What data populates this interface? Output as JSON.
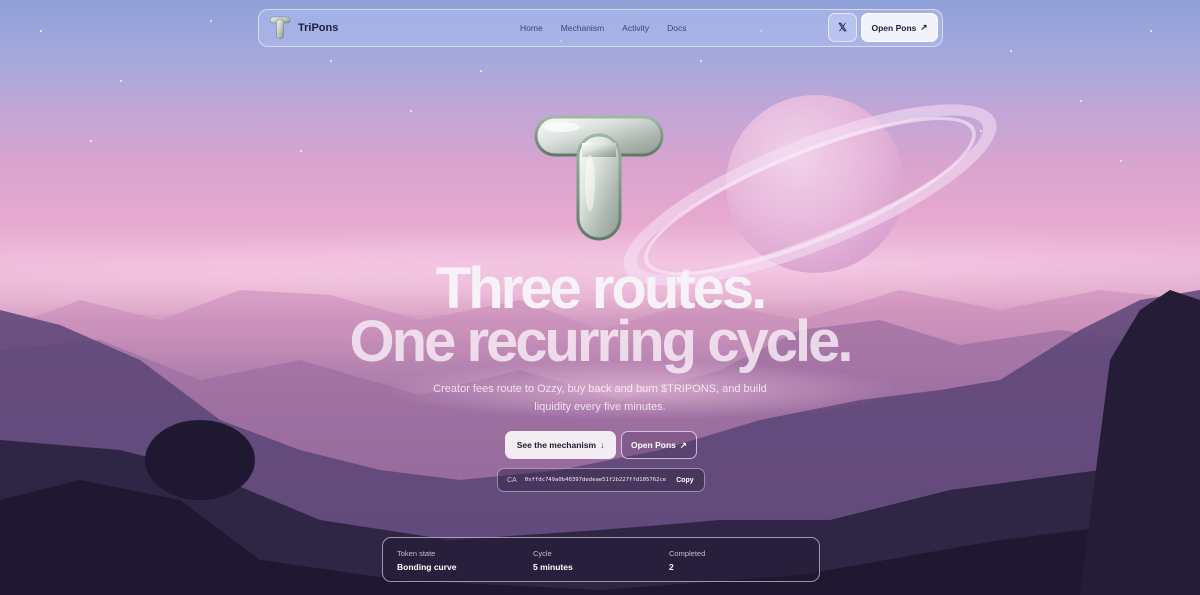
{
  "nav": {
    "brand": "TriPons",
    "links": [
      "Home",
      "Mechanism",
      "Activity",
      "Docs"
    ],
    "x_label": "𝕏",
    "open_pons": "Open Pons",
    "open_pons_arrow": "↗"
  },
  "hero": {
    "headline_1": "Three routes.",
    "headline_2": "One recurring cycle.",
    "subtitle": "Creator fees route to Ozzy, buy back and burn $TRIPONS, and build liquidity every five minutes.",
    "cta_primary": "See the mechanism",
    "cta_primary_arrow": "↓",
    "cta_secondary": "Open Pons",
    "cta_secondary_arrow": "↗"
  },
  "contract": {
    "label": "CA",
    "address": "0xffdc749a0b40397dedeae51f2b227ffd105762ce",
    "copy_label": "Copy"
  },
  "stats": [
    {
      "label": "Token state",
      "value": "Bonding curve"
    },
    {
      "label": "Cycle",
      "value": "5 minutes"
    },
    {
      "label": "Completed",
      "value": "2"
    }
  ]
}
